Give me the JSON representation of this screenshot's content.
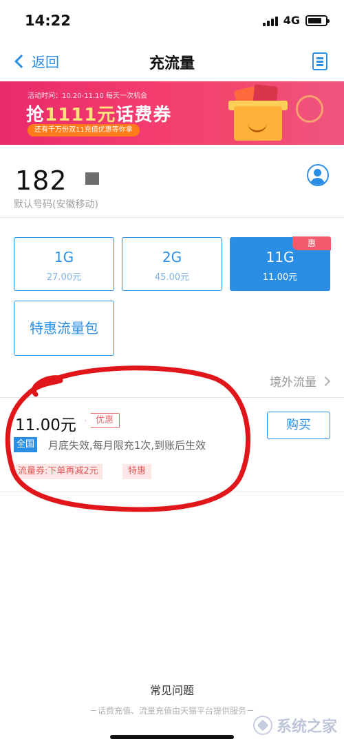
{
  "status_bar": {
    "time": "14:22",
    "network": "4G"
  },
  "nav": {
    "back_label": "返回",
    "title": "充流量"
  },
  "banner": {
    "activity_time": "活动时间：10.20-11.10  每天一次机会",
    "title_prefix": "抢",
    "title_highlight": "1111元",
    "title_suffix": "话费券",
    "subtitle": "还有千万份双11充值优惠等你拿"
  },
  "phone": {
    "number": "182",
    "note": "默认号码(安徽移动)"
  },
  "plans": [
    {
      "size": "1G",
      "price": "27.00元",
      "selected": false
    },
    {
      "size": "2G",
      "price": "45.00元",
      "selected": false
    },
    {
      "size": "11G",
      "price": "11.00元",
      "selected": true,
      "tag": "惠"
    }
  ],
  "special_pack_label": "特惠流量包",
  "overseas_label": "境外流量",
  "offer": {
    "price": "11.00元",
    "promo_tag": "优惠",
    "scope_tag": "全国",
    "description": "月底失效,每月限充1次,到账后生效",
    "coupon_text": "流量券:下单再减2元",
    "special_tag": "特惠",
    "buy_label": "购买"
  },
  "footer": {
    "faq_label": "常见问题",
    "note": "－话费充值、流量充值由天猫平台提供服务－"
  },
  "watermark": {
    "text": "系统之家"
  },
  "colors": {
    "accent": "#2a8ee5",
    "promo_red": "#e86a6a",
    "annotation_red": "#e0161b"
  }
}
